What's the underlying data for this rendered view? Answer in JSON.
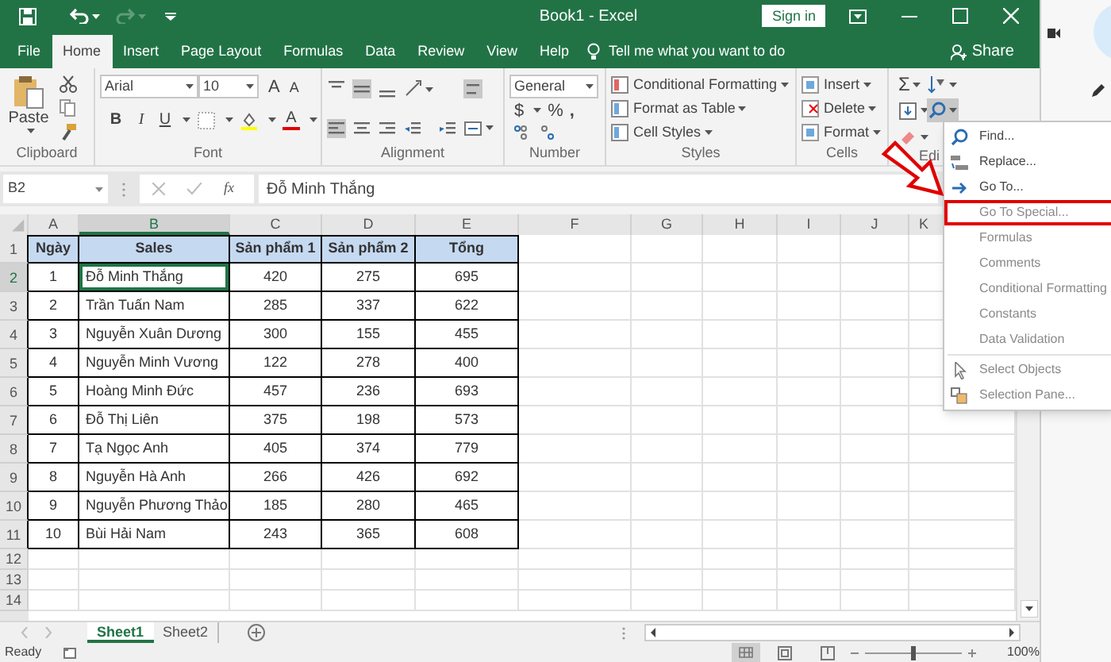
{
  "window": {
    "title": "Book1 - Excel",
    "sign_in": "Sign in"
  },
  "ribbon_tabs": [
    {
      "label": "File",
      "selected": false
    },
    {
      "label": "Home",
      "selected": true
    },
    {
      "label": "Insert",
      "selected": false
    },
    {
      "label": "Page Layout",
      "selected": false
    },
    {
      "label": "Formulas",
      "selected": false
    },
    {
      "label": "Data",
      "selected": false
    },
    {
      "label": "Review",
      "selected": false
    },
    {
      "label": "View",
      "selected": false
    },
    {
      "label": "Help",
      "selected": false
    }
  ],
  "tell_me": "Tell me what you want to do",
  "share": "Share",
  "ribbon": {
    "clipboard": {
      "paste": "Paste",
      "label": "Clipboard"
    },
    "font": {
      "name": "Arial",
      "size": "10",
      "grow": "A",
      "shrink": "A",
      "bold": "B",
      "italic": "I",
      "underline": "U",
      "font_color": "A",
      "label": "Font"
    },
    "alignment": {
      "label": "Alignment"
    },
    "number": {
      "format": "General",
      "currency": "$",
      "percent": "%",
      "comma": ",",
      "label": "Number"
    },
    "styles": {
      "items": [
        "Conditional Formatting",
        "Format as Table",
        "Cell Styles"
      ],
      "label": "Styles"
    },
    "cells": {
      "items": [
        "Insert",
        "Delete",
        "Format"
      ],
      "label": "Cells"
    },
    "editing": {
      "sum": "Σ",
      "label": "Edi"
    }
  },
  "formula_bar": {
    "name_box": "B2",
    "function": "fx",
    "value": "Đỗ Minh Thắng"
  },
  "sheet": {
    "columns": [
      {
        "label": "A",
        "selected": false
      },
      {
        "label": "B",
        "selected": true
      },
      {
        "label": "C",
        "selected": false
      },
      {
        "label": "D",
        "selected": false
      },
      {
        "label": "E",
        "selected": false
      },
      {
        "label": "F",
        "selected": false
      },
      {
        "label": "G",
        "selected": false
      },
      {
        "label": "H",
        "selected": false
      },
      {
        "label": "I",
        "selected": false
      },
      {
        "label": "J",
        "selected": false
      },
      {
        "label": "K",
        "selected": false
      }
    ],
    "row_numbers": [
      {
        "label": "1",
        "selected": false
      },
      {
        "label": "2",
        "selected": true
      },
      {
        "label": "3",
        "selected": false
      },
      {
        "label": "4",
        "selected": false
      },
      {
        "label": "5",
        "selected": false
      },
      {
        "label": "6",
        "selected": false
      },
      {
        "label": "7",
        "selected": false
      },
      {
        "label": "8",
        "selected": false
      },
      {
        "label": "9",
        "selected": false
      },
      {
        "label": "10",
        "selected": false
      },
      {
        "label": "11",
        "selected": false
      },
      {
        "label": "12",
        "selected": false
      },
      {
        "label": "13",
        "selected": false
      },
      {
        "label": "14",
        "selected": false
      }
    ],
    "rows": [
      {
        "kind": "header",
        "cells": [
          "Ngày",
          "Sales",
          "Sản phẩm 1",
          "Sản phẩm 2",
          "Tổng"
        ]
      },
      {
        "kind": "data",
        "cells": [
          "1",
          "Đỗ Minh Thắng",
          "420",
          "275",
          "695"
        ]
      },
      {
        "kind": "data",
        "cells": [
          "2",
          "Trần Tuấn Nam",
          "285",
          "337",
          "622"
        ]
      },
      {
        "kind": "data",
        "cells": [
          "3",
          "Nguyễn Xuân Dương",
          "300",
          "155",
          "455"
        ]
      },
      {
        "kind": "data",
        "cells": [
          "4",
          "Nguyễn Minh Vương",
          "122",
          "278",
          "400"
        ]
      },
      {
        "kind": "data",
        "cells": [
          "5",
          "Hoàng Minh Đức",
          "457",
          "236",
          "693"
        ]
      },
      {
        "kind": "data",
        "cells": [
          "6",
          "Đỗ Thị Liên",
          "375",
          "198",
          "573"
        ]
      },
      {
        "kind": "data",
        "cells": [
          "7",
          "Tạ Ngọc Anh",
          "405",
          "374",
          "779"
        ]
      },
      {
        "kind": "data",
        "cells": [
          "8",
          "Nguyễn Hà Anh",
          "266",
          "426",
          "692"
        ]
      },
      {
        "kind": "data",
        "cells": [
          "9",
          "Nguyễn Phương Thảo",
          "185",
          "280",
          "465"
        ]
      },
      {
        "kind": "data",
        "cells": [
          "10",
          "Bùi Hải Nam",
          "243",
          "365",
          "608"
        ]
      }
    ]
  },
  "find_menu": {
    "sections": [
      [
        {
          "label": "Find...",
          "kind": "find",
          "disabled": false,
          "highlighted": false
        },
        {
          "label": "Replace...",
          "kind": "replace",
          "disabled": false,
          "highlighted": false
        },
        {
          "label": "Go To...",
          "kind": "goto",
          "disabled": false,
          "highlighted": false
        },
        {
          "label": "Go To Special...",
          "kind": "plain",
          "disabled": true,
          "highlighted": true
        },
        {
          "label": "Formulas",
          "kind": "plain",
          "disabled": true,
          "highlighted": false
        },
        {
          "label": "Comments",
          "kind": "plain",
          "disabled": true,
          "highlighted": false
        },
        {
          "label": "Conditional Formatting",
          "kind": "plain",
          "disabled": true,
          "highlighted": false
        },
        {
          "label": "Constants",
          "kind": "plain",
          "disabled": true,
          "highlighted": false
        },
        {
          "label": "Data Validation",
          "kind": "plain",
          "disabled": true,
          "highlighted": false
        }
      ],
      [
        {
          "label": "Select Objects",
          "kind": "pointer",
          "disabled": true,
          "highlighted": false
        },
        {
          "label": "Selection Pane...",
          "kind": "pane",
          "disabled": true,
          "highlighted": false
        }
      ]
    ]
  },
  "sheet_tabs": [
    {
      "label": "Sheet1",
      "selected": true
    },
    {
      "label": "Sheet2",
      "selected": false
    }
  ],
  "status_bar": {
    "status": "Ready",
    "zoom": {
      "level": 0.5,
      "reading": "100%"
    }
  }
}
